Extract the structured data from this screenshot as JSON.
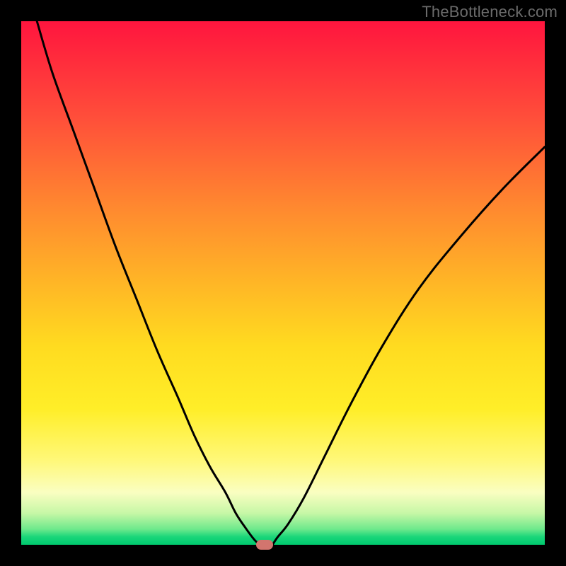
{
  "watermark": "TheBottleneck.com",
  "chart_data": {
    "type": "line",
    "title": "",
    "xlabel": "",
    "ylabel": "",
    "xlim": [
      0,
      100
    ],
    "ylim": [
      0,
      100
    ],
    "grid": false,
    "legend": false,
    "series": [
      {
        "name": "left-branch",
        "x": [
          3,
          6,
          10,
          14,
          18,
          22,
          26,
          30,
          33,
          36,
          39,
          41,
          43,
          44.5,
          45.5
        ],
        "y": [
          100,
          90,
          79,
          68,
          57,
          47,
          37,
          28,
          21,
          15,
          10,
          6,
          3,
          1,
          0
        ]
      },
      {
        "name": "right-branch",
        "x": [
          48,
          49,
          51,
          54,
          58,
          63,
          69,
          76,
          84,
          92,
          100
        ],
        "y": [
          0,
          1.5,
          4,
          9,
          17,
          27,
          38,
          49,
          59,
          68,
          76
        ]
      }
    ],
    "annotations": [
      {
        "name": "minimum-marker",
        "x": 46.5,
        "y": 0,
        "shape": "pill",
        "color": "#d2756e"
      }
    ],
    "gradient_stops": [
      {
        "pos": 0.0,
        "color": "#ff153e"
      },
      {
        "pos": 0.18,
        "color": "#ff4d3a"
      },
      {
        "pos": 0.36,
        "color": "#ff8a2f"
      },
      {
        "pos": 0.5,
        "color": "#ffb626"
      },
      {
        "pos": 0.62,
        "color": "#ffdb20"
      },
      {
        "pos": 0.74,
        "color": "#ffee28"
      },
      {
        "pos": 0.84,
        "color": "#fff87a"
      },
      {
        "pos": 0.9,
        "color": "#fafec1"
      },
      {
        "pos": 0.94,
        "color": "#c6f7a6"
      },
      {
        "pos": 0.97,
        "color": "#6ee98c"
      },
      {
        "pos": 0.985,
        "color": "#19d67a"
      },
      {
        "pos": 1.0,
        "color": "#00c96e"
      }
    ]
  }
}
